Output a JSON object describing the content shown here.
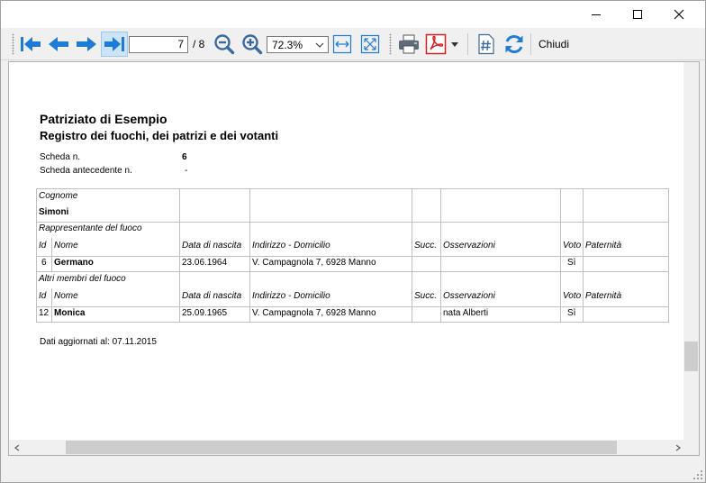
{
  "toolbar": {
    "current_page": "7",
    "total_pages": "/ 8",
    "zoom_level": "72.3%",
    "close_label": "Chiudi"
  },
  "document": {
    "title": "Patriziato di Esempio",
    "subtitle": "Registro dei fuochi, dei patrizi e dei votanti",
    "scheda_label": "Scheda n.",
    "scheda_value": "6",
    "antecedente_label": "Scheda antecedente n.",
    "antecedente_value": "-",
    "cognome_label": "Cognome",
    "cognome_value": "Simoni",
    "rappresentante_label": "Rappresentante del fuoco",
    "altri_label": "Altri membri del fuoco",
    "columns": [
      "Id",
      "Nome",
      "Data di nascita",
      "Indirizzo - Domicilio",
      "Succ.",
      "Osservazioni",
      "Voto",
      "Paternità"
    ],
    "rappresentante": {
      "id": "6",
      "nome": "Germano",
      "nascita": "23.06.1964",
      "indirizzo": "V. Campagnola 7, 6928 Manno",
      "succ": "",
      "osservazioni": "",
      "voto": "Sì",
      "paternita": ""
    },
    "altri": [
      {
        "id": "12",
        "nome": "Monica",
        "nascita": "25.09.1965",
        "indirizzo": "V. Campagnola 7, 6928 Manno",
        "succ": "",
        "osservazioni": "nata Alberti",
        "voto": "Sì",
        "paternita": ""
      }
    ],
    "footer": "Dati aggiornati al: 07.11.2015"
  },
  "colors": {
    "accent_blue": "#1e7bd6",
    "pdf_red": "#d42020",
    "grid_line": "#c0c0c0"
  },
  "icons": {
    "first": "first-page-icon",
    "prev": "previous-page-icon",
    "next": "next-page-icon",
    "last": "last-page-icon",
    "zoom_out": "zoom-out-icon",
    "zoom_in": "zoom-in-icon",
    "fit_width": "fit-width-icon",
    "fit_page": "fit-page-icon",
    "print": "printer-icon",
    "pdf": "pdf-export-icon",
    "hash": "hash-document-icon",
    "refresh": "refresh-icon"
  }
}
